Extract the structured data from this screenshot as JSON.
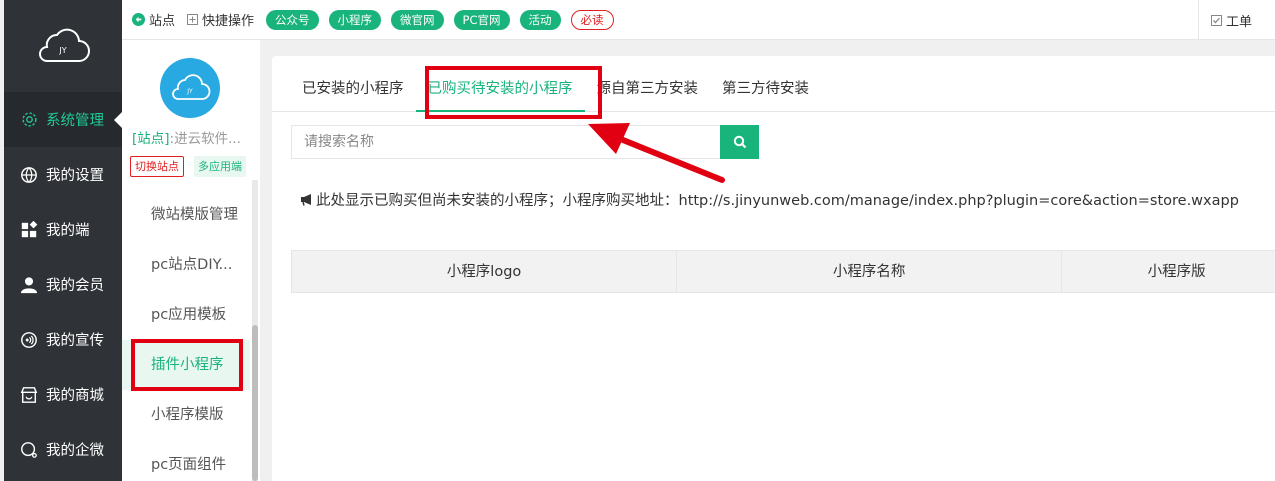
{
  "sidebar": {
    "logo_text": "JY",
    "items": [
      {
        "label": "系统管理",
        "icon": "gear-icon",
        "active": true
      },
      {
        "label": "我的设置",
        "icon": "globe-icon",
        "active": false
      },
      {
        "label": "我的端",
        "icon": "apps-icon",
        "active": false
      },
      {
        "label": "我的会员",
        "icon": "user-icon",
        "active": false
      },
      {
        "label": "我的宣传",
        "icon": "broadcast-icon",
        "active": false
      },
      {
        "label": "我的商城",
        "icon": "shop-icon",
        "active": false
      },
      {
        "label": "我的企微",
        "icon": "chat-icon",
        "active": false
      }
    ]
  },
  "topbar": {
    "site_label": "站点",
    "quick_label": "快捷操作",
    "pills": [
      "公众号",
      "小程序",
      "微官网",
      "PC官网",
      "活动"
    ],
    "must_read": "必读",
    "ticket_label": "工单"
  },
  "site": {
    "avatar_text": "JY",
    "name_prefix": "[站点]",
    "name": ":进云软件...",
    "switch_label": "切换站点",
    "multi_label": "多应用端"
  },
  "sub_menu": {
    "items": [
      {
        "label": "微站模版管理",
        "active": false
      },
      {
        "label": "pc站点DIY...",
        "active": false
      },
      {
        "label": "pc应用模板",
        "active": false
      },
      {
        "label": "插件小程序",
        "active": true
      },
      {
        "label": "小程序模版",
        "active": false
      },
      {
        "label": "pc页面组件",
        "active": false
      }
    ]
  },
  "tabs": [
    {
      "label": "已安装的小程序",
      "active": false
    },
    {
      "label": "已购买待安装的小程序",
      "active": true
    },
    {
      "label": "源自第三方安装",
      "active": false
    },
    {
      "label": "第三方待安装",
      "active": false
    }
  ],
  "search": {
    "placeholder": "请搜索名称"
  },
  "notice": "此处显示已购买但尚未安装的小程序；小程序购买地址：http://s.jinyunweb.com/manage/index.php?plugin=core&action=store.wxapp",
  "table": {
    "columns": [
      "小程序logo",
      "小程序名称",
      "小程序版"
    ]
  },
  "colors": {
    "accent": "#19b37c",
    "sidebar_bg": "#2f3236",
    "highlight": "#e00012",
    "avatar": "#29a9e1"
  }
}
